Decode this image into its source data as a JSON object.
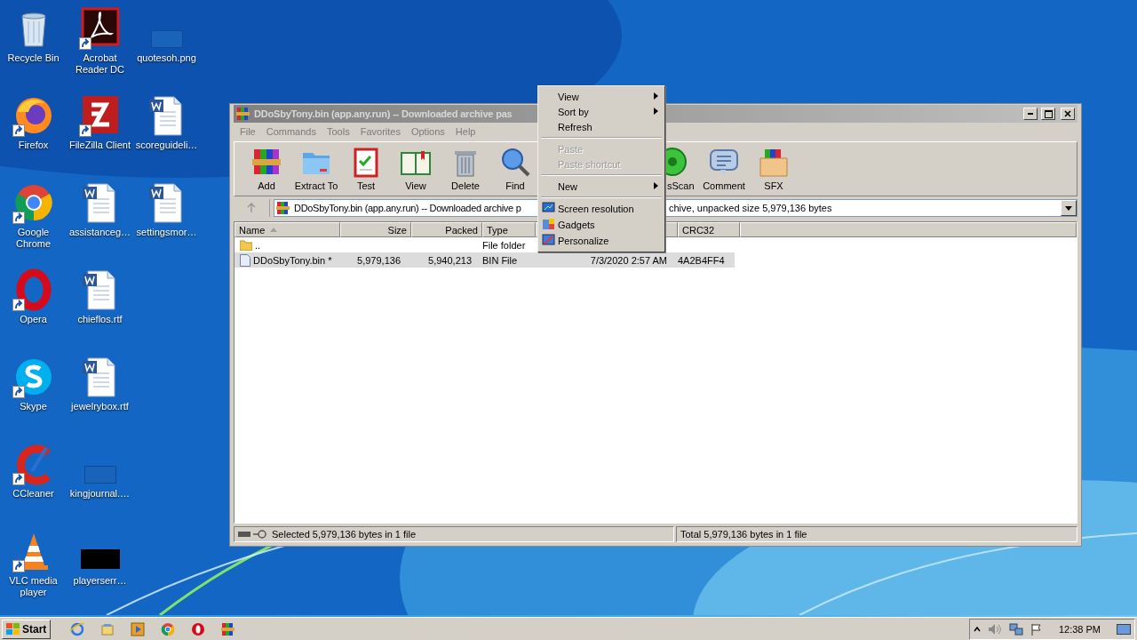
{
  "desktop": {
    "icons": [
      {
        "label": "Recycle Bin",
        "kind": "recycle",
        "shortcut": false
      },
      {
        "label": "Firefox",
        "kind": "firefox",
        "shortcut": true
      },
      {
        "label": "Google Chrome",
        "kind": "chrome",
        "shortcut": true
      },
      {
        "label": "Opera",
        "kind": "opera",
        "shortcut": true
      },
      {
        "label": "Skype",
        "kind": "skype",
        "shortcut": true
      },
      {
        "label": "CCleaner",
        "kind": "ccleaner",
        "shortcut": true
      },
      {
        "label": "VLC media player",
        "kind": "vlc",
        "shortcut": true
      },
      {
        "label": "Acrobat Reader DC",
        "kind": "acrobat",
        "shortcut": true
      },
      {
        "label": "FileZilla Client",
        "kind": "filezilla",
        "shortcut": true
      },
      {
        "label": "assistanceg…",
        "kind": "word",
        "shortcut": false
      },
      {
        "label": "chieflos.rtf",
        "kind": "word",
        "shortcut": false
      },
      {
        "label": "jewelrybox.rtf",
        "kind": "word",
        "shortcut": false
      },
      {
        "label": "kingjournal.…",
        "kind": "blank",
        "shortcut": false
      },
      {
        "label": "playerserr…",
        "kind": "dark",
        "shortcut": false
      },
      {
        "label": "quotesoh.png",
        "kind": "blank",
        "shortcut": false
      },
      {
        "label": "scoreguideli…",
        "kind": "word",
        "shortcut": false
      },
      {
        "label": "settingsmor…",
        "kind": "word",
        "shortcut": false
      }
    ]
  },
  "window": {
    "title": "DDoSbyTony.bin (app.any.run) -- Downloaded archive pas",
    "menu": [
      "File",
      "Commands",
      "Tools",
      "Favorites",
      "Options",
      "Help"
    ],
    "toolbar": [
      {
        "label": "Add",
        "kind": "add"
      },
      {
        "label": "Extract To",
        "kind": "extract"
      },
      {
        "label": "Test",
        "kind": "test"
      },
      {
        "label": "View",
        "kind": "view"
      },
      {
        "label": "Delete",
        "kind": "delete"
      },
      {
        "label": "Find",
        "kind": "find"
      },
      {
        "label": "sScan",
        "kind": "virusscan"
      },
      {
        "label": "Comment",
        "kind": "comment"
      },
      {
        "label": "SFX",
        "kind": "sfx"
      }
    ],
    "address": {
      "left": "DDoSbyTony.bin (app.any.run) -- Downloaded archive p",
      "right": "chive, unpacked size 5,979,136 bytes"
    },
    "columns": [
      {
        "label": "Name",
        "sorted": true
      },
      {
        "label": "Size",
        "sorted": false
      },
      {
        "label": "Packed",
        "sorted": false
      },
      {
        "label": "Type",
        "sorted": false
      },
      {
        "sorted": false
      },
      {
        "label": "CRC32",
        "sorted": false
      }
    ],
    "rows": [
      {
        "kind": "folder",
        "name": "..",
        "type": "File folder",
        "selected": false
      },
      {
        "kind": "file",
        "name": "DDoSbyTony.bin *",
        "size": "5,979,136",
        "packed": "5,940,213",
        "type": "BIN File",
        "modified": "7/3/2020 2:57 AM",
        "crc32": "4A2B4FF4",
        "selected": true
      }
    ],
    "status": {
      "selected": "Selected 5,979,136 bytes in 1 file",
      "total": "Total 5,979,136 bytes in 1 file"
    }
  },
  "context_menu": {
    "items": [
      {
        "kind": "item",
        "label": "View",
        "submenu": true,
        "disabled": false
      },
      {
        "kind": "item",
        "label": "Sort by",
        "submenu": true,
        "disabled": false
      },
      {
        "kind": "item",
        "label": "Refresh",
        "submenu": false,
        "disabled": false
      },
      {
        "kind": "separator"
      },
      {
        "kind": "item",
        "label": "Paste",
        "submenu": false,
        "disabled": true
      },
      {
        "kind": "item",
        "label": "Paste shortcut",
        "submenu": false,
        "disabled": true
      },
      {
        "kind": "separator"
      },
      {
        "kind": "item",
        "label": "New",
        "submenu": true,
        "disabled": false
      },
      {
        "kind": "separator"
      },
      {
        "kind": "display",
        "label": "Screen resolution",
        "submenu": false,
        "disabled": false
      },
      {
        "kind": "gadgets",
        "label": "Gadgets",
        "submenu": false,
        "disabled": false
      },
      {
        "kind": "personalize",
        "label": "Personalize",
        "submenu": false,
        "disabled": false
      }
    ]
  },
  "taskbar": {
    "start": "Start",
    "apps": [
      {
        "kind": "ie"
      },
      {
        "kind": "explorer"
      },
      {
        "kind": "media"
      },
      {
        "kind": "chrome"
      },
      {
        "kind": "opera"
      },
      {
        "kind": "winrar"
      }
    ],
    "clock": "12:38 PM"
  }
}
